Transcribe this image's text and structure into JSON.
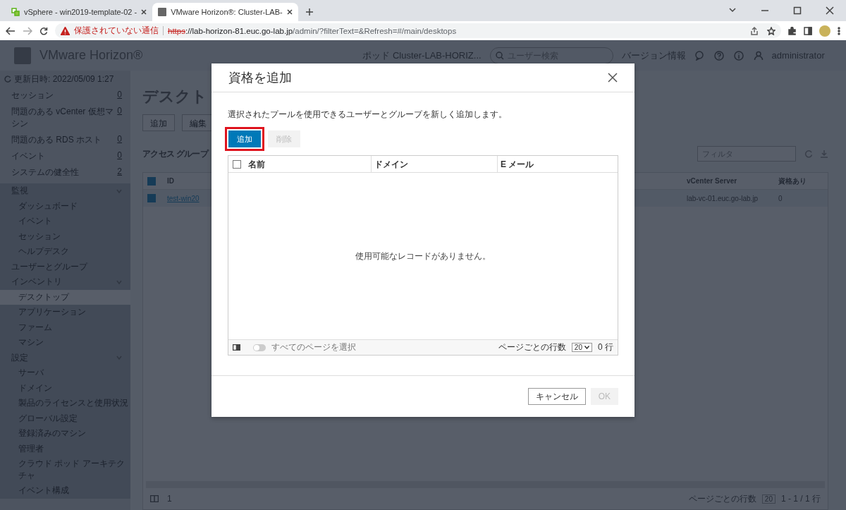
{
  "browser": {
    "tabs": [
      {
        "title": "vSphere - win2019-template-02 -",
        "kind": "vsphere",
        "selected": false
      },
      {
        "title": "VMware Horizon®: Cluster-LAB-",
        "kind": "vm",
        "selected": true
      }
    ],
    "address_bar": {
      "security_label": "保護されていない通信",
      "url_scheme": "https",
      "url_host": "://lab-horizon-81.euc.go-lab.jp",
      "url_path": "/admin/?filterText=&Refresh=#/main/desktops"
    }
  },
  "app_header": {
    "product": "VMware Horizon®",
    "pod": "ポッド Cluster-LAB-HORIZ...",
    "search": {
      "placeholder": "ユーザー検索"
    },
    "about": "バージョン情報",
    "user": "administrator"
  },
  "sidebar": {
    "updated": "更新日時: 2022/05/09 1:27",
    "counters": [
      {
        "label": "セッション",
        "count": "0"
      },
      {
        "label": "問題のある vCenter 仮想マシン",
        "count": "0"
      },
      {
        "label": "問題のある RDS ホスト",
        "count": "0"
      },
      {
        "label": "イベント",
        "count": "0"
      },
      {
        "label": "システムの健全性",
        "count": "2"
      }
    ],
    "nav": [
      {
        "label": "監視",
        "selected": false,
        "expanded": true,
        "children": [
          {
            "label": "ダッシュボード",
            "selected": false
          },
          {
            "label": "イベント",
            "selected": false
          },
          {
            "label": "セッション",
            "selected": false
          },
          {
            "label": "ヘルプデスク",
            "selected": false
          }
        ]
      },
      {
        "label": "ユーザーとグループ",
        "selected": false
      },
      {
        "label": "インベントリ",
        "selected": false,
        "expanded": true,
        "children": [
          {
            "label": "デスクトップ",
            "selected": true
          },
          {
            "label": "アプリケーション",
            "selected": false
          },
          {
            "label": "ファーム",
            "selected": false
          },
          {
            "label": "マシン",
            "selected": false
          }
        ]
      },
      {
        "label": "設定",
        "selected": false,
        "expanded": true,
        "children": [
          {
            "label": "サーバ",
            "selected": false
          },
          {
            "label": "ドメイン",
            "selected": false
          },
          {
            "label": "製品のライセンスと使用状況",
            "selected": false
          },
          {
            "label": "グローバル設定",
            "selected": false
          },
          {
            "label": "登録済みのマシン",
            "selected": false
          },
          {
            "label": "管理者",
            "selected": false
          },
          {
            "label": "クラウド ポッド アーキテクチャ",
            "selected": false
          },
          {
            "label": "イベント構成",
            "selected": false
          }
        ]
      }
    ]
  },
  "main": {
    "title": "デスクト",
    "buttons": [
      "追加",
      "編集"
    ],
    "access_group_label": "アクセス グループ",
    "filter": {
      "placeholder": "フィルタ"
    },
    "table": {
      "all_checked": true,
      "columns": [
        "ID",
        "vCenter Server",
        "資格あり"
      ],
      "rows": [
        {
          "checked": true,
          "id": "test-win20",
          "vcenter": "lab-vc-01.euc.go-lab.jp",
          "entitled": "0"
        }
      ]
    },
    "footer": {
      "page": "1",
      "rows_per_page_label": "ページごとの行数",
      "rows_per_page": "20",
      "range": "1 - 1 / 1 行"
    }
  },
  "dialog": {
    "title": "資格を追加",
    "description": "選択されたプールを使用できるユーザーとグループを新しく追加します。",
    "toolbar": [
      {
        "label": "追加",
        "disabled": false,
        "highlighted": true
      },
      {
        "label": "削除",
        "disabled": true,
        "highlighted": false
      }
    ],
    "grid": {
      "all_checked": false,
      "columns": [
        "名前",
        "ドメイン",
        "E メール"
      ],
      "empty_message": "使用可能なレコードがありません。",
      "select_all_pages": {
        "label": "すべてのページを選択",
        "on": false
      },
      "rows_per_page_label": "ページごとの行数",
      "rows_per_page": "20",
      "count": "0 行"
    },
    "buttons": [
      {
        "label": "キャンセル",
        "disabled": false
      },
      {
        "label": "OK",
        "disabled": true
      }
    ]
  }
}
